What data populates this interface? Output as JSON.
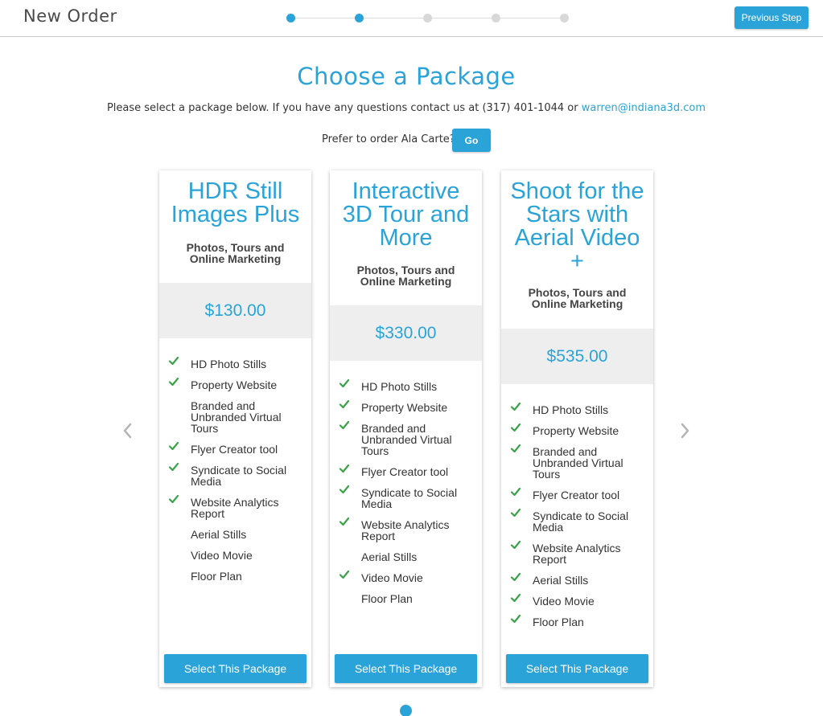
{
  "header": {
    "title": "New Order",
    "previous_label": "Previous Step",
    "steps": [
      {
        "state": "complete"
      },
      {
        "state": "current"
      },
      {
        "state": "pending"
      },
      {
        "state": "pending"
      },
      {
        "state": "pending"
      }
    ]
  },
  "intro": {
    "title": "Choose a Package",
    "text": "Please select a package below. If you have any questions contact us at (317) 401-1044 or ",
    "email": "warren@indiana3d.com",
    "ala_carte_label": "Prefer to order Ala Carte?",
    "go_label": "Go"
  },
  "packages": [
    {
      "title": "HDR Still Images Plus",
      "subtitle": "Photos, Tours and Online Marketing",
      "price": "$130.00",
      "features": [
        {
          "label": "HD Photo Stills",
          "included": true
        },
        {
          "label": "Property Website",
          "included": true
        },
        {
          "label": "Branded and Unbranded Virtual Tours",
          "included": false
        },
        {
          "label": "Flyer Creator tool",
          "included": true
        },
        {
          "label": "Syndicate to Social Media",
          "included": true
        },
        {
          "label": "Website Analytics Report",
          "included": true
        },
        {
          "label": "Aerial Stills",
          "included": false
        },
        {
          "label": "Video Movie",
          "included": false
        },
        {
          "label": "Floor Plan",
          "included": false
        }
      ],
      "select_label": "Select This Package"
    },
    {
      "title": "Interactive 3D Tour and More",
      "subtitle": "Photos, Tours and Online Marketing",
      "price": "$330.00",
      "features": [
        {
          "label": "HD Photo Stills",
          "included": true
        },
        {
          "label": "Property Website",
          "included": true
        },
        {
          "label": "Branded and Unbranded Virtual Tours",
          "included": true
        },
        {
          "label": "Flyer Creator tool",
          "included": true
        },
        {
          "label": "Syndicate to Social Media",
          "included": true
        },
        {
          "label": "Website Analytics Report",
          "included": true
        },
        {
          "label": "Aerial Stills",
          "included": false
        },
        {
          "label": "Video Movie",
          "included": true
        },
        {
          "label": "Floor Plan",
          "included": false
        }
      ],
      "select_label": "Select This Package"
    },
    {
      "title": "Shoot for the Stars with Aerial Video +",
      "subtitle": "Photos, Tours and Online Marketing",
      "price": "$535.00",
      "features": [
        {
          "label": "HD Photo Stills",
          "included": true
        },
        {
          "label": "Property Website",
          "included": true
        },
        {
          "label": "Branded and Unbranded Virtual Tours",
          "included": true
        },
        {
          "label": "Flyer Creator tool",
          "included": true
        },
        {
          "label": "Syndicate to Social Media",
          "included": true
        },
        {
          "label": "Website Analytics Report",
          "included": true
        },
        {
          "label": "Aerial Stills",
          "included": true
        },
        {
          "label": "Video Movie",
          "included": true
        },
        {
          "label": "Floor Plan",
          "included": true
        }
      ],
      "select_label": "Select This Package"
    }
  ],
  "carousel": {
    "prev_icon": "chevron-left-icon",
    "next_icon": "chevron-right-icon"
  },
  "colors": {
    "accent": "#2aa3d8",
    "price_bg": "#eeeeee",
    "check": "#3aa34a",
    "step_inactive": "#d8d8d8"
  }
}
